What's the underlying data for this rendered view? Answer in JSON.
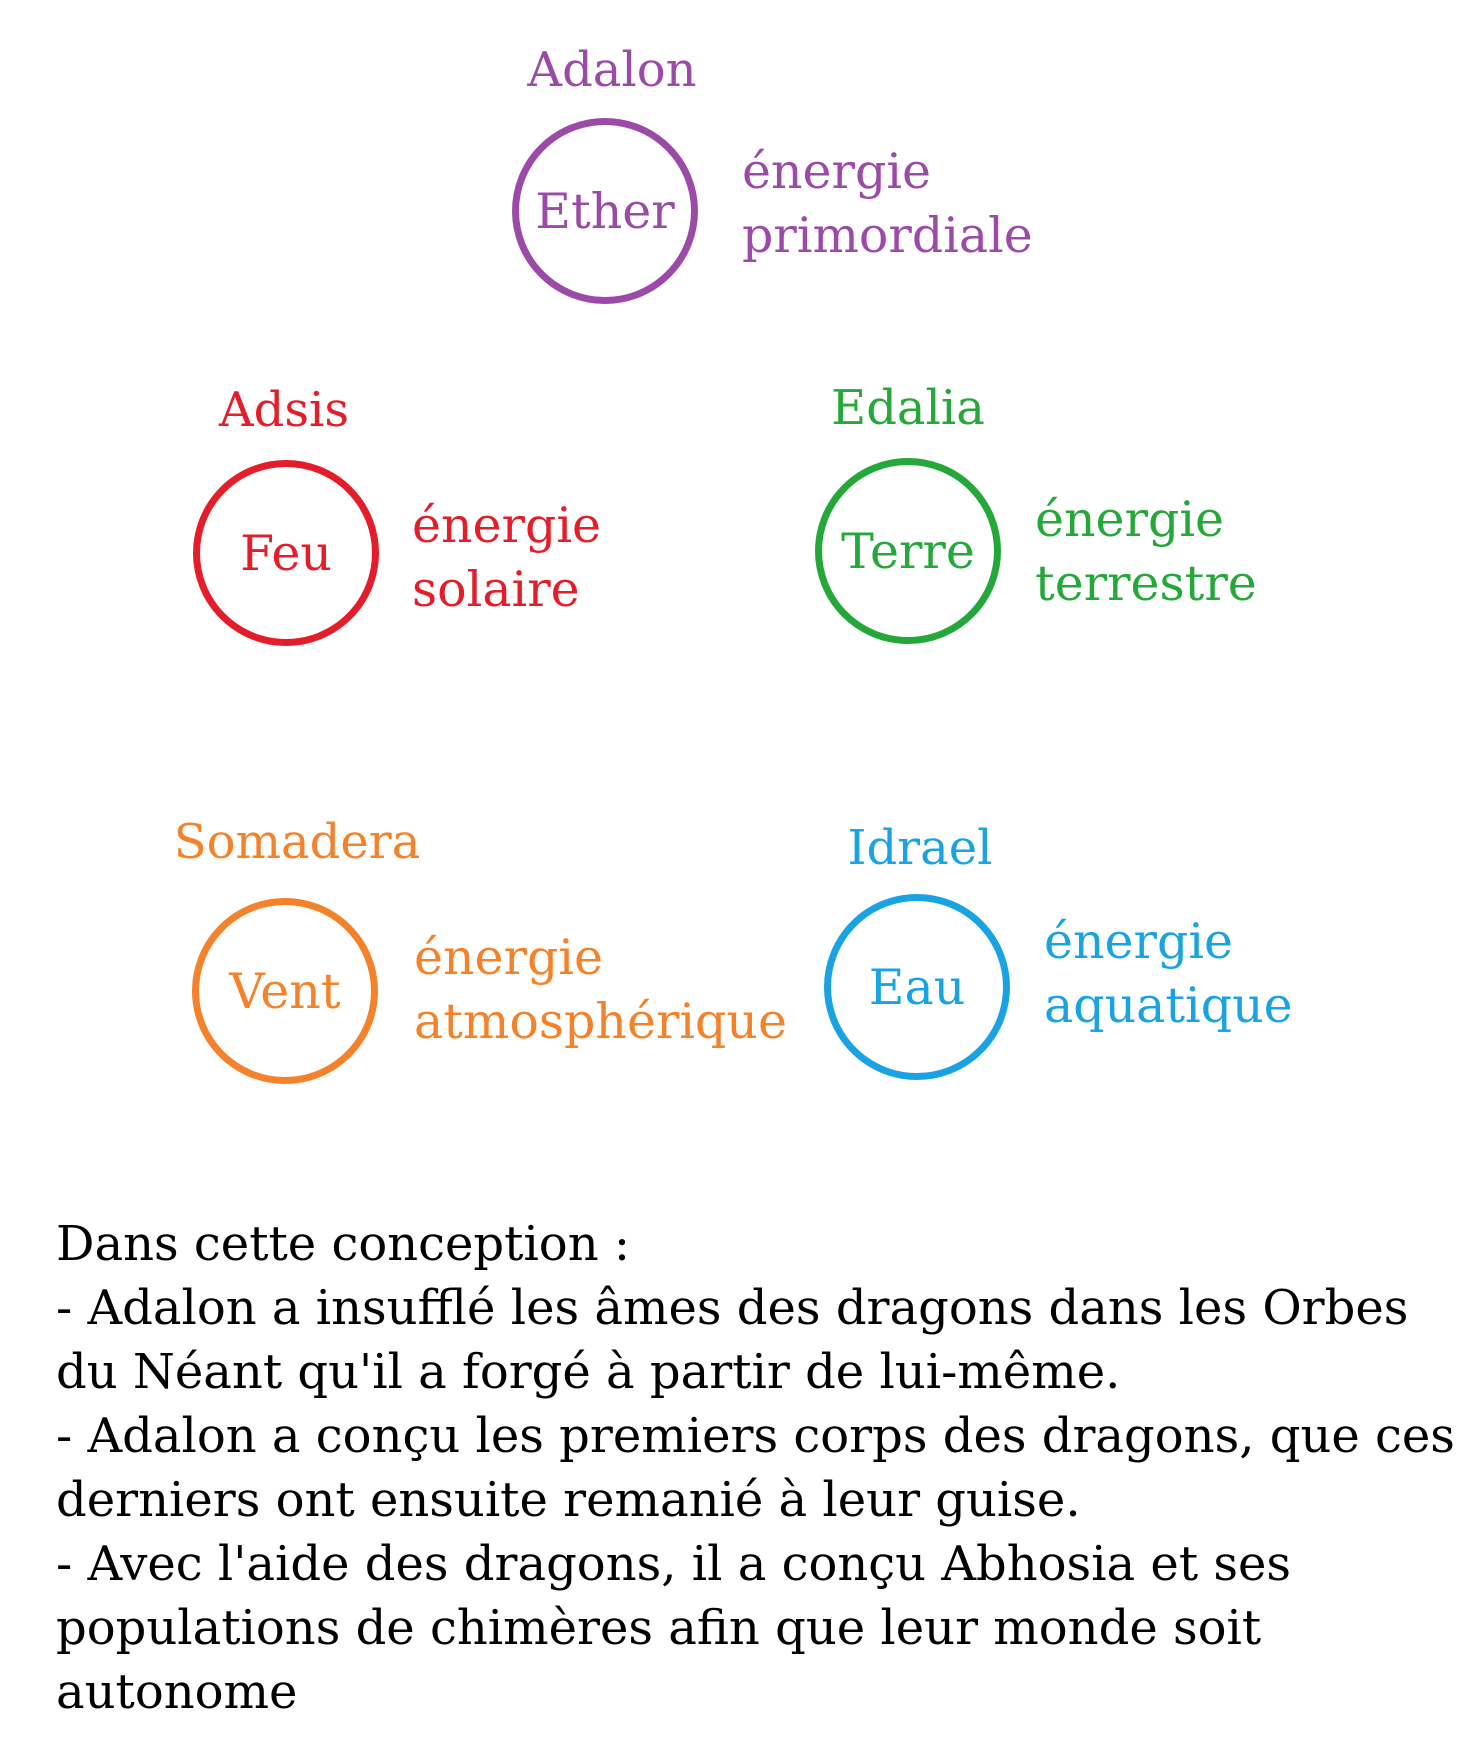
{
  "nodes": [
    {
      "id": "ether",
      "name": "Adalon",
      "element": "Ether",
      "energy_line1": "énergie",
      "energy_line2": "primordiale",
      "color": "#9b4aa8"
    },
    {
      "id": "feu",
      "name": "Adsis",
      "element": "Feu",
      "energy_line1": "énergie",
      "energy_line2": "solaire",
      "color": "#e31e2a"
    },
    {
      "id": "terre",
      "name": "Edalia",
      "element": "Terre",
      "energy_line1": "énergie",
      "energy_line2": "terrestre",
      "color": "#25a83a"
    },
    {
      "id": "vent",
      "name": "Somadera",
      "element": "Vent",
      "energy_line1": "énergie",
      "energy_line2": "atmosphérique",
      "color": "#f4822a"
    },
    {
      "id": "eau",
      "name": "Idrael",
      "element": "Eau",
      "energy_line1": "énergie",
      "energy_line2": "aquatique",
      "color": "#1aa3e2"
    }
  ],
  "notes": {
    "heading": "Dans cette conception :",
    "items": [
      "- Adalon a insufflé les âmes des dragons dans les Orbes du Néant qu'il a forgé à partir de lui-même.",
      "- Adalon a conçu les premiers corps des dragons, que ces derniers ont ensuite remanié à leur guise.",
      "- Avec l'aide des dragons, il a conçu Abhosia et ses populations de chimères afin que leur monde soit autonome"
    ]
  }
}
